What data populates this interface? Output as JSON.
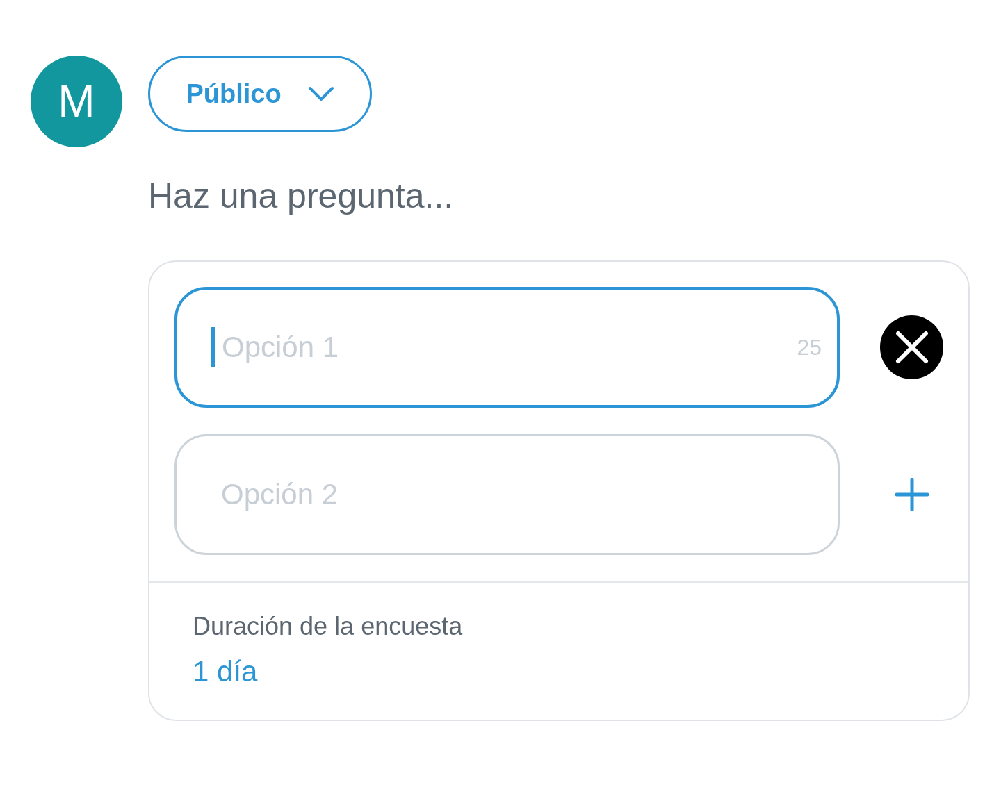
{
  "avatar": {
    "initial": "M"
  },
  "audience": {
    "label": "Público"
  },
  "question": {
    "placeholder": "Haz una pregunta..."
  },
  "options": [
    {
      "placeholder": "Opción 1",
      "focused": true,
      "counter": "25",
      "action": {
        "kind": "remove"
      }
    },
    {
      "placeholder": "Opción 2",
      "focused": false,
      "action": {
        "kind": "add"
      }
    }
  ],
  "duration": {
    "label": "Duración de la encuesta",
    "value": "1 día"
  }
}
